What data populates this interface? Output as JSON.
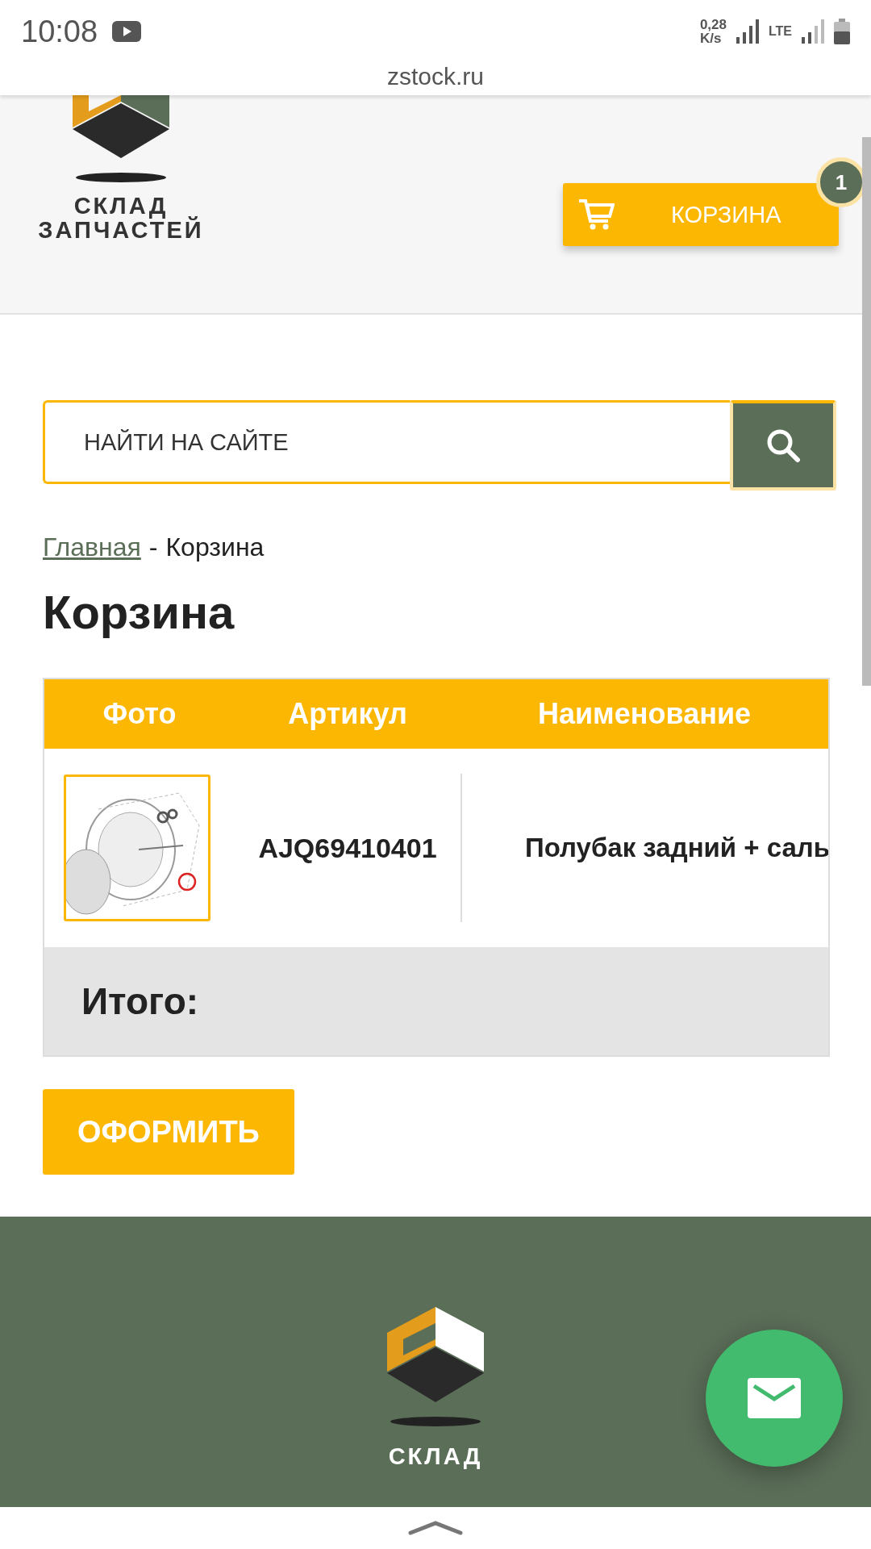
{
  "status_bar": {
    "time": "10:08",
    "speed_value": "0,28",
    "speed_unit": "K/s",
    "network": "LTE"
  },
  "browser": {
    "url": "zstock.ru"
  },
  "header": {
    "logo_lines": [
      "СКЛАД",
      "ЗАПЧАСТЕЙ"
    ],
    "cart": {
      "label": "КОРЗИНА",
      "count": "1"
    }
  },
  "search": {
    "placeholder": "НАЙТИ НА САЙТЕ"
  },
  "breadcrumbs": [
    {
      "label": "Главная",
      "kind": "link"
    },
    {
      "label": "-",
      "kind": "separator"
    },
    {
      "label": "Корзина",
      "kind": "current"
    }
  ],
  "title": "Корзина",
  "table": {
    "columns": [
      "Фото",
      "Артикул",
      "Наименование"
    ],
    "rows": [
      {
        "article": "AJQ69410401",
        "name": "Полубак задний + саль"
      }
    ],
    "total_label": "Итого:"
  },
  "checkout_button": "ОФОРМИТЬ",
  "footer": {
    "logo_lines": [
      "СКЛАД"
    ]
  }
}
